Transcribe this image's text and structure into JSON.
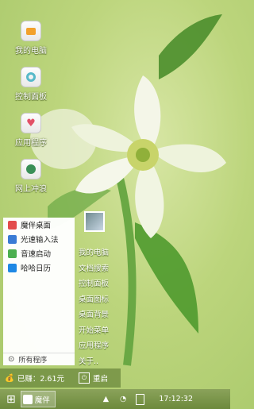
{
  "desktop": {
    "icons": [
      {
        "label": "我的电脑",
        "icon": "computer-icon"
      },
      {
        "label": "控制面板",
        "icon": "control-panel-icon"
      },
      {
        "label": "应用程序",
        "icon": "apps-heart-icon"
      },
      {
        "label": "网上冲浪",
        "icon": "browser-icon"
      }
    ]
  },
  "start_menu": {
    "pinned": [
      {
        "label": "魔伴桌面",
        "icon": "mobanzhuomian-icon",
        "color": "#e34c4c"
      },
      {
        "label": "光速输入法",
        "icon": "input-method-icon",
        "color": "#3a7bd5"
      },
      {
        "label": "音速启动",
        "icon": "v-launcher-icon",
        "color": "#4caf50"
      },
      {
        "label": "哈哈日历",
        "icon": "calendar-icon",
        "color": "#1e88e5"
      }
    ],
    "all_programs": "所有程序",
    "links": [
      "我的电脑",
      "文档搜索",
      "控制面板",
      "桌面图标",
      "桌面背景",
      "开始菜单",
      "应用程序",
      "关于.."
    ],
    "earned": "已赚：2.61元",
    "restart": "重启"
  },
  "taskbar": {
    "task_label": "魔伴",
    "clock": "17:12:32",
    "accent": "#6d8a3c"
  }
}
